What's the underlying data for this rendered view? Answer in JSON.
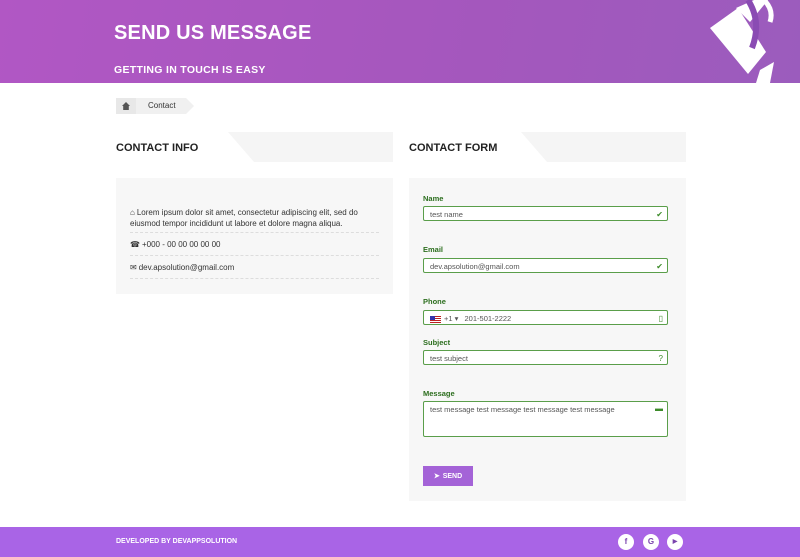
{
  "hero": {
    "title": "SEND US MESSAGE",
    "subtitle": "GETTING IN TOUCH IS EASY"
  },
  "breadcrumb": {
    "current": "Contact"
  },
  "contact_info": {
    "heading": "CONTACT INFO",
    "address": "Lorem ipsum dolor sit amet, consectetur adipiscing elit, sed do eiusmod tempor incididunt ut labore et dolore magna aliqua.",
    "phone": "+000 - 00 00 00 00 00",
    "email": "dev.apsolution@gmail.com"
  },
  "contact_form": {
    "heading": "CONTACT FORM",
    "name_label": "Name",
    "name_value": "test name",
    "email_label": "Email",
    "email_value": "dev.apsolution@gmail.com",
    "phone_label": "Phone",
    "phone_code": "+1",
    "phone_value": "201-501-2222",
    "subject_label": "Subject",
    "subject_value": "test subject",
    "message_label": "Message",
    "message_value": "test message test message test message test message",
    "send_label": "SEND"
  },
  "footer": {
    "credit": "DEVELOPED BY DEVAPPSOLUTION",
    "social": [
      "f",
      "G",
      "▶"
    ]
  },
  "colors": {
    "accent": "#a964e6",
    "valid": "#5a9e4a"
  }
}
